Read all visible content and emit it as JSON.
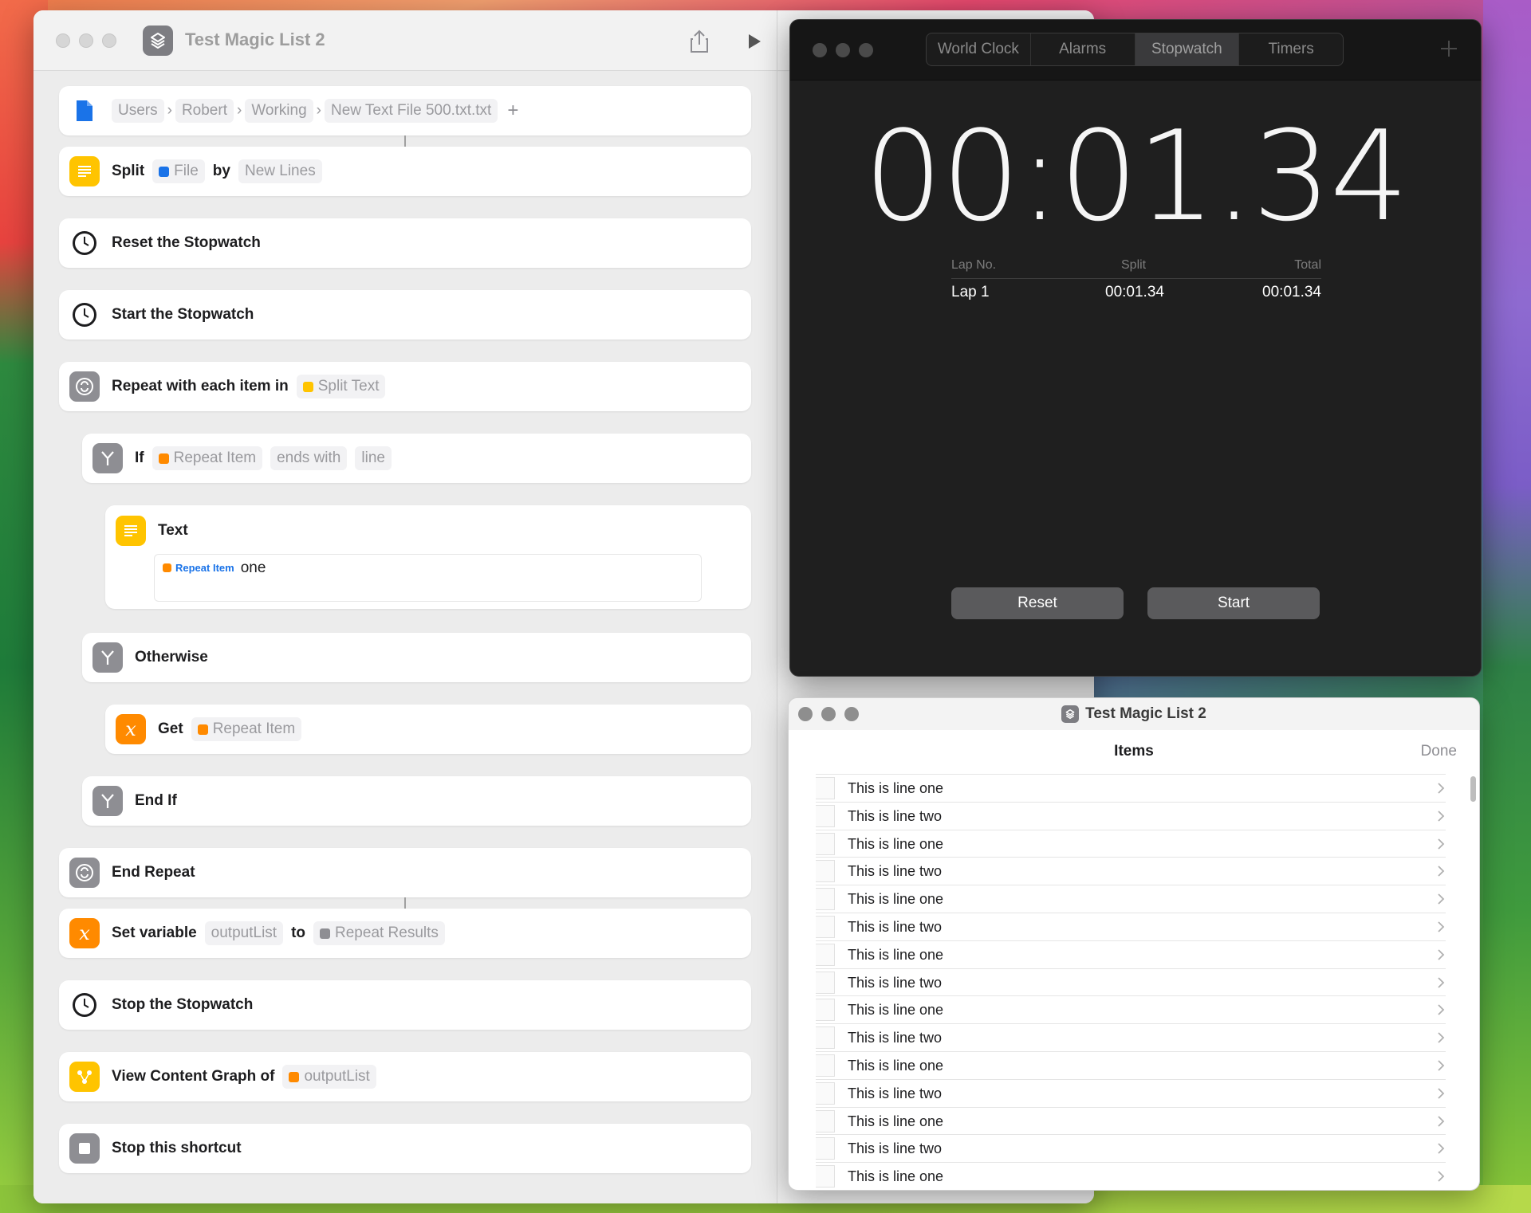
{
  "shortcuts": {
    "title": "Test Magic List 2",
    "path": [
      "Users",
      "Robert",
      "Working",
      "New Text File 500.txt.txt"
    ],
    "actions": {
      "split": {
        "label": "Split",
        "file": "File",
        "by": "by",
        "mode": "New Lines"
      },
      "reset": {
        "label": "Reset the Stopwatch"
      },
      "start": {
        "label": "Start the Stopwatch"
      },
      "repeat": {
        "label": "Repeat with each item in",
        "token": "Split Text"
      },
      "if": {
        "label": "If",
        "token": "Repeat Item",
        "cond": "ends with",
        "value": "line"
      },
      "text": {
        "label": "Text",
        "token": "Repeat Item",
        "content": "one"
      },
      "otherwise": {
        "label": "Otherwise"
      },
      "get": {
        "label": "Get",
        "token": "Repeat Item"
      },
      "endif": {
        "label": "End If"
      },
      "endrepeat": {
        "label": "End Repeat"
      },
      "setvar": {
        "label": "Set variable",
        "var": "outputList",
        "to": "to",
        "token": "Repeat Results"
      },
      "stop": {
        "label": "Stop the Stopwatch"
      },
      "graph": {
        "label": "View Content Graph of",
        "token": "outputList"
      },
      "stopshortcut": {
        "label": "Stop this shortcut"
      }
    }
  },
  "clock": {
    "tabs": [
      "World Clock",
      "Alarms",
      "Stopwatch",
      "Timers"
    ],
    "active_tab": "Stopwatch",
    "time": "00:01.34",
    "lap_headers": {
      "lap": "Lap No.",
      "split": "Split",
      "total": "Total"
    },
    "laps": [
      {
        "lap": "Lap 1",
        "split": "00:01.34",
        "total": "00:01.34"
      }
    ],
    "reset_label": "Reset",
    "start_label": "Start"
  },
  "result": {
    "title": "Test Magic List 2",
    "items_title": "Items",
    "done_label": "Done",
    "items": [
      "This is line one",
      "This is line two",
      "This is line one",
      "This is line two",
      "This is line one",
      "This is line two",
      "This is line one",
      "This is line two",
      "This is line one",
      "This is line two",
      "This is line one",
      "This is line two",
      "This is line one",
      "This is line two",
      "This is line one"
    ]
  }
}
